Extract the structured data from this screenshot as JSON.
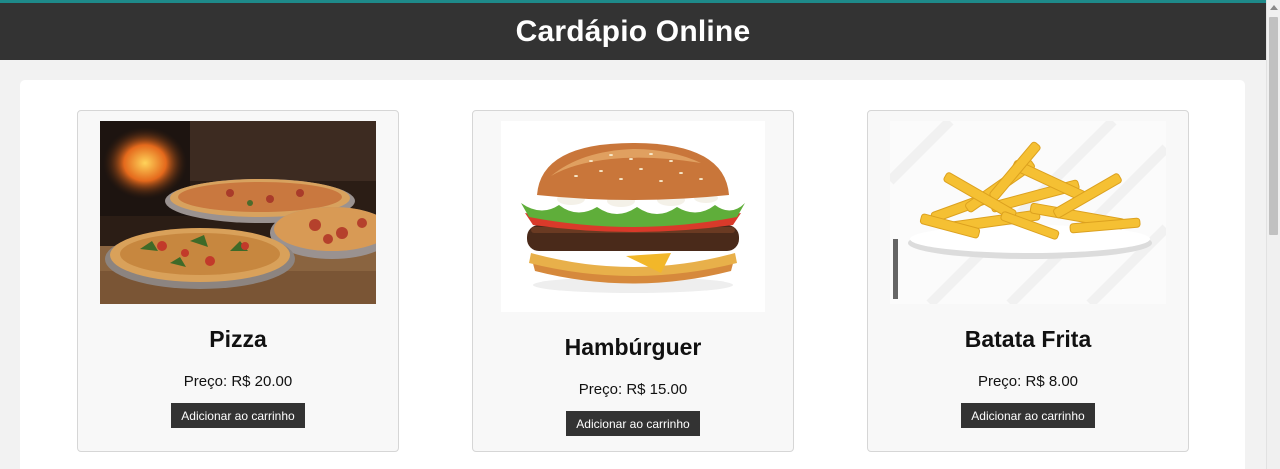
{
  "header": {
    "title": "Cardápio Online"
  },
  "colors": {
    "header_bg": "#333333",
    "button_bg": "#333333",
    "accent_line": "#1e8a8a"
  },
  "products": [
    {
      "name": "Pizza",
      "price_label": "Preço:",
      "price_value": "R$ 20.00",
      "button_label": "Adicionar ao carrinho"
    },
    {
      "name": "Hambúrguer",
      "price_label": "Preço:",
      "price_value": "R$ 15.00",
      "button_label": "Adicionar ao carrinho"
    },
    {
      "name": "Batata Frita",
      "price_label": "Preço:",
      "price_value": "R$ 8.00",
      "button_label": "Adicionar ao carrinho"
    }
  ]
}
